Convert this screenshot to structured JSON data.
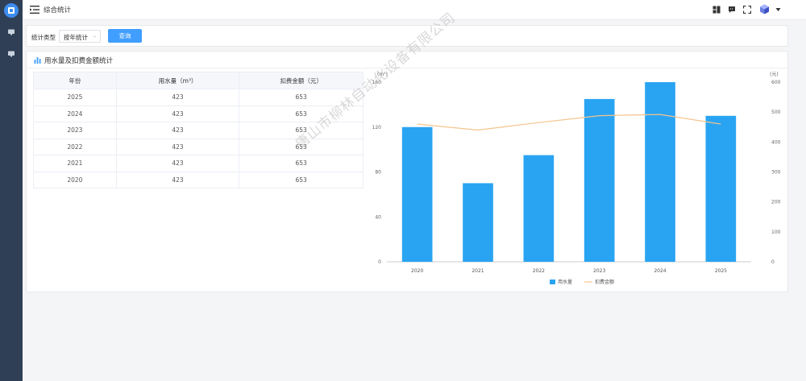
{
  "header": {
    "title": "综合统计"
  },
  "filter": {
    "label": "统计类型",
    "select_value": "按年统计",
    "query_label": "查询"
  },
  "panel": {
    "title": "用水量及扣费金额统计"
  },
  "table": {
    "columns": [
      "年份",
      "用水量（m³）",
      "扣费金额（元）"
    ],
    "rows": [
      [
        "2025",
        "423",
        "653"
      ],
      [
        "2024",
        "423",
        "653"
      ],
      [
        "2023",
        "423",
        "653"
      ],
      [
        "2022",
        "423",
        "653"
      ],
      [
        "2021",
        "423",
        "653"
      ],
      [
        "2020",
        "423",
        "653"
      ]
    ]
  },
  "watermark": "唐山市柳林自动化设备有限公司",
  "colors": {
    "sidebar": "#2f3f55",
    "primary": "#409eff",
    "bar": "#29a4f2",
    "line": "#f5c48d"
  },
  "chart_data": {
    "type": "bar",
    "categories": [
      "2020",
      "2021",
      "2022",
      "2023",
      "2024",
      "2025"
    ],
    "series": [
      {
        "name": "用水量",
        "type": "bar",
        "axis": "left",
        "values": [
          120,
          70,
          95,
          145,
          160,
          130
        ]
      },
      {
        "name": "扣费金额",
        "type": "line",
        "axis": "right",
        "values": [
          460,
          440,
          465,
          488,
          492,
          460
        ]
      }
    ],
    "ylabel_left": "(m³)",
    "ylabel_right": "(元)",
    "ylim_left": [
      0,
      160
    ],
    "ylim_right": [
      0,
      600
    ],
    "yticks_left": [
      "0",
      "40",
      "80",
      "120",
      "160"
    ],
    "yticks_right": [
      "0",
      "100",
      "200",
      "300",
      "400",
      "500",
      "600"
    ],
    "grid": false,
    "legend_position": "bottom-center"
  }
}
